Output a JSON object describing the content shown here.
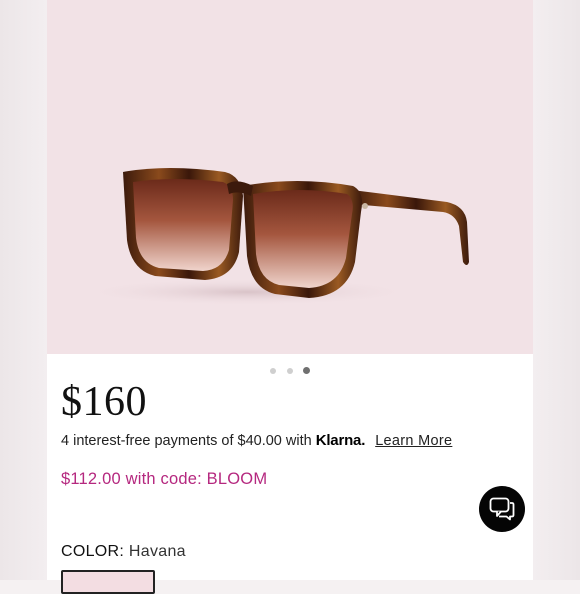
{
  "pricing": {
    "price": "$160",
    "installments_text": "4 interest-free payments of $40.00 with",
    "klarna_brand": "Klarna.",
    "learn_more_label": "Learn More",
    "promo_text": "$112.00 with code: BLOOM"
  },
  "carousel": {
    "dot_count": 3,
    "active_index": 2
  },
  "product": {
    "color_label": "COLOR:",
    "color_value": "Havana"
  },
  "icons": {
    "chat": "chat-bubbles-icon"
  },
  "colors": {
    "promo": "#b5287f",
    "image_background": "#f2e2e6",
    "chat_button": "#050505"
  }
}
